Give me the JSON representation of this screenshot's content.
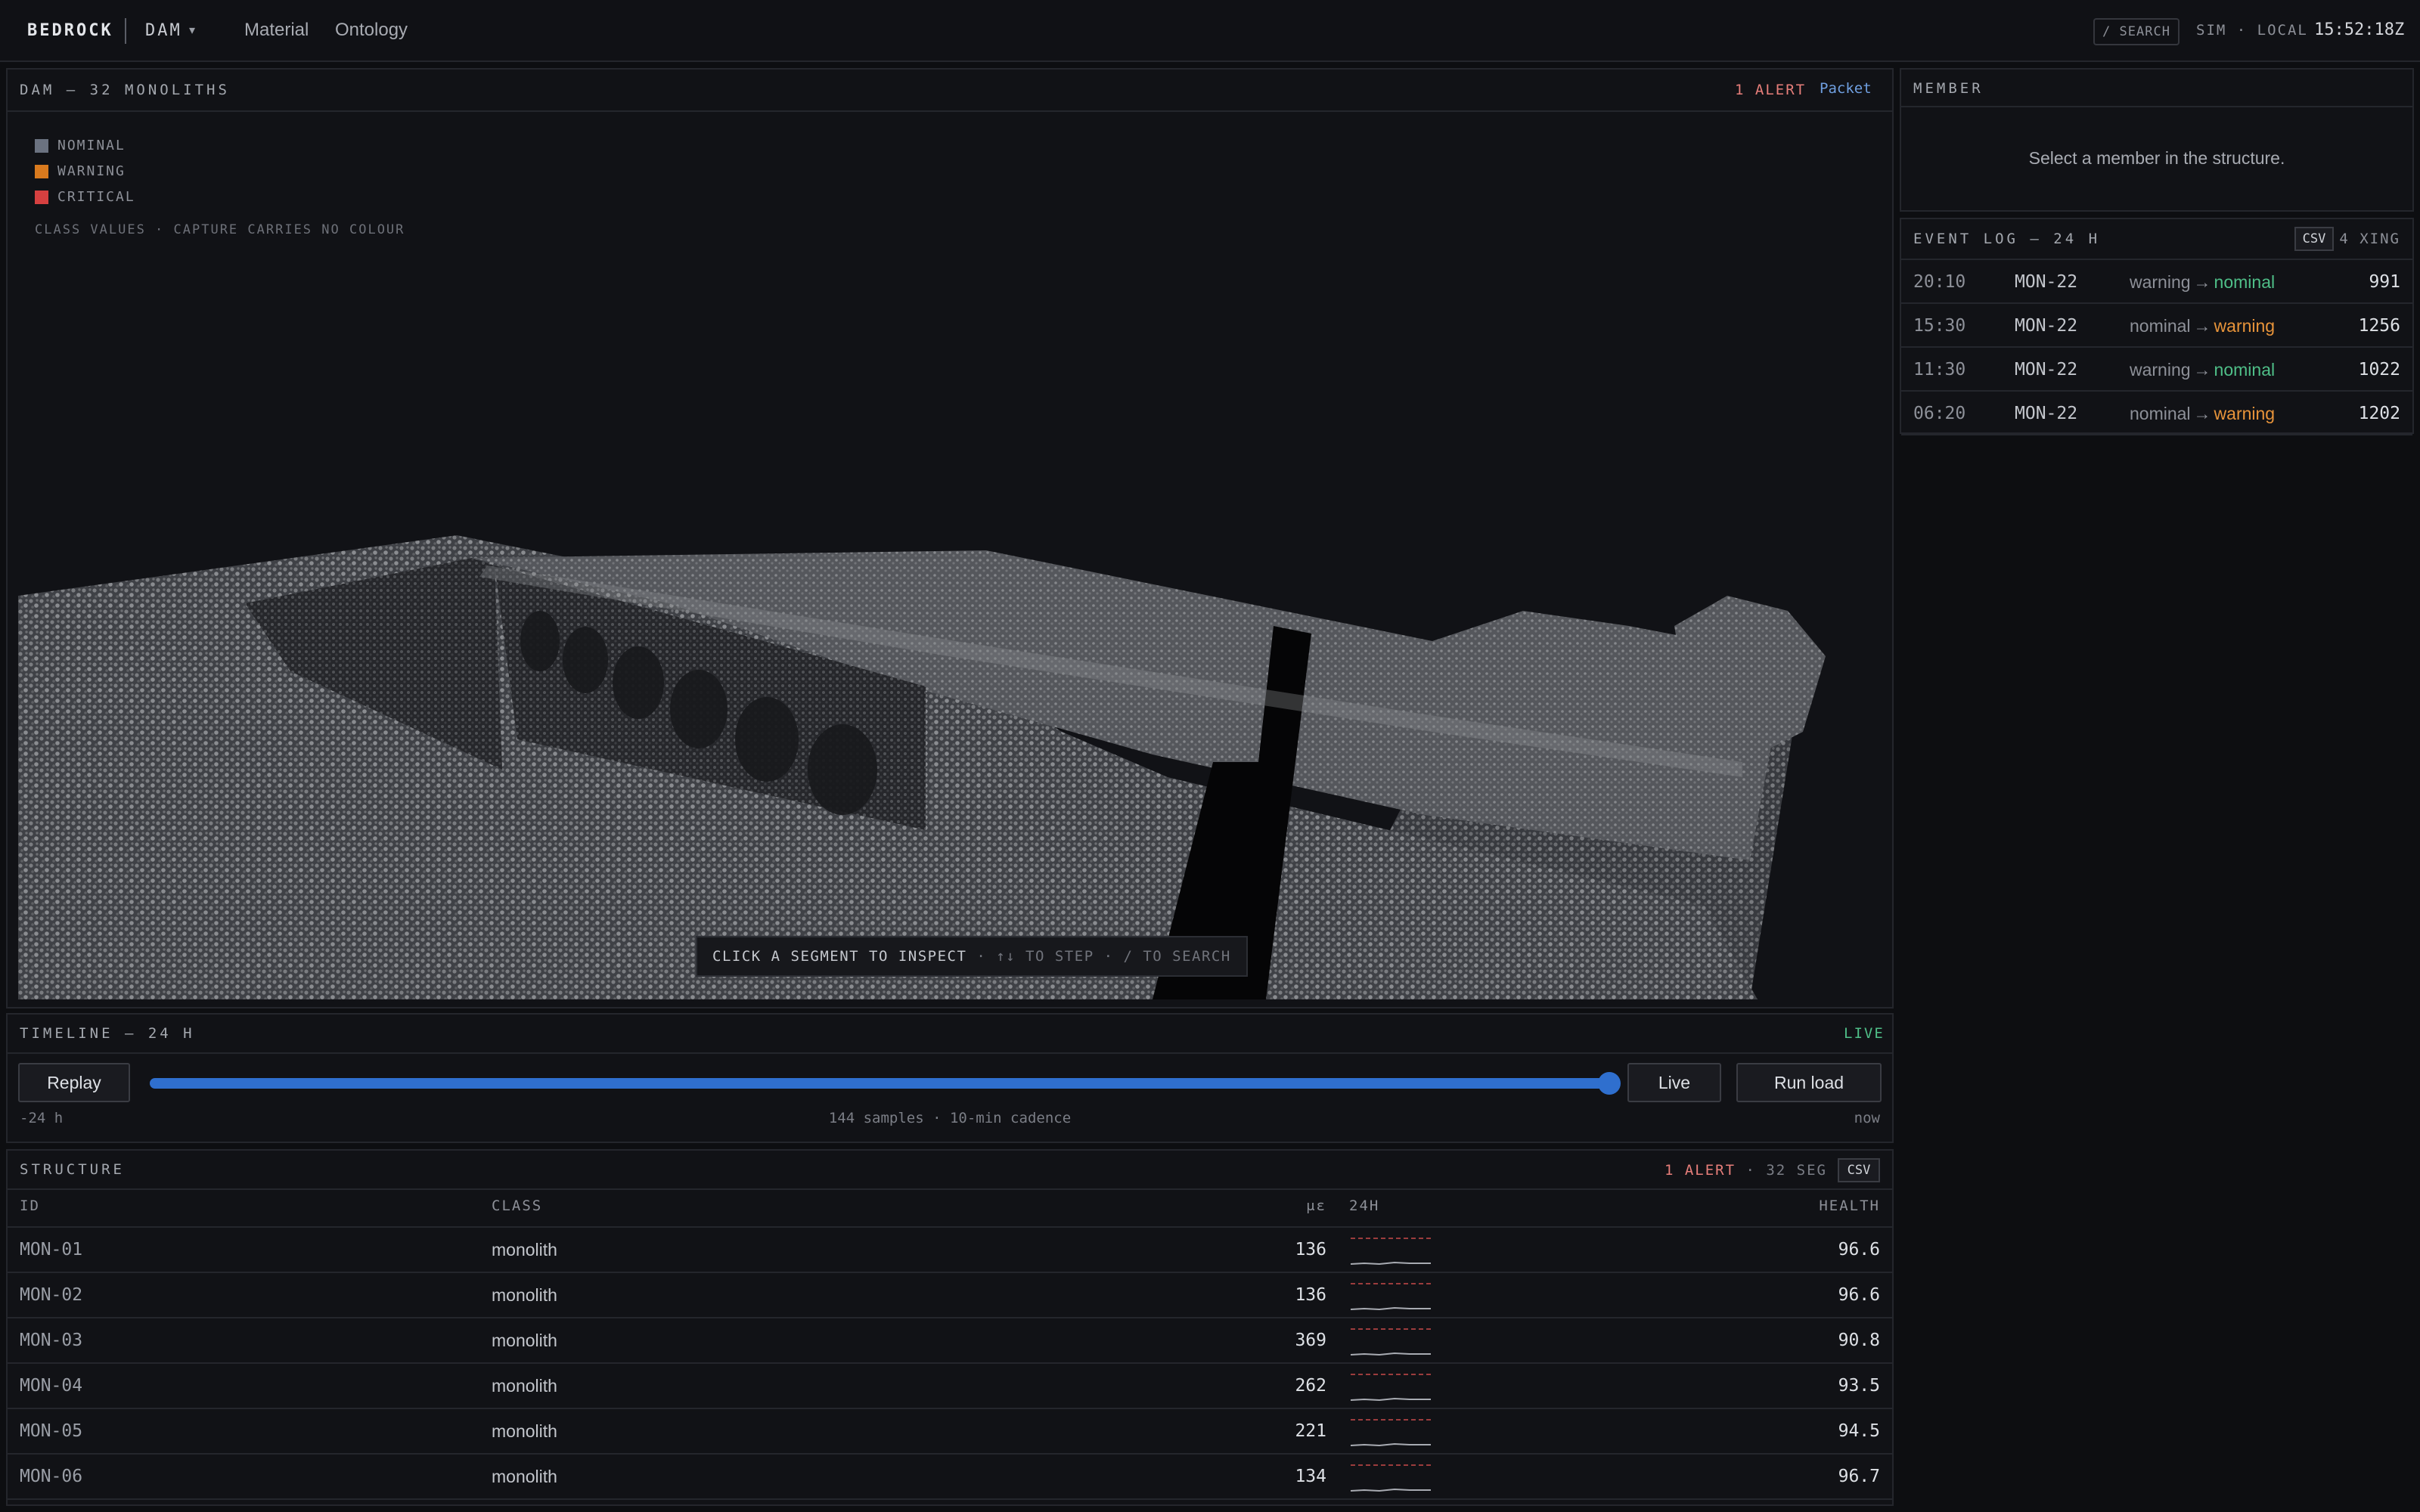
{
  "topbar": {
    "brand": "BEDROCK",
    "project": "DAM",
    "project_caret": "▾",
    "nav": [
      "Material",
      "Ontology"
    ],
    "search": "/ SEARCH",
    "env": "SIM · LOCAL",
    "clock": "15:52:18Z"
  },
  "viewport": {
    "title": "DAM — 32 MONOLITHS",
    "alert": "1 ALERT",
    "packet": "Packet",
    "legend": [
      {
        "label": "NOMINAL",
        "color": "#6b7280"
      },
      {
        "label": "WARNING",
        "color": "#d97a1e"
      },
      {
        "label": "CRITICAL",
        "color": "#d64040"
      }
    ],
    "legend_note": "CLASS VALUES · CAPTURE CARRIES NO COLOUR",
    "hint_a": "CLICK A SEGMENT TO INSPECT",
    "hint_b": " · ↑↓ TO STEP · / TO SEARCH"
  },
  "timeline": {
    "title": "TIMELINE — 24 H",
    "live_badge": "LIVE",
    "replay": "Replay",
    "live": "Live",
    "run_load": "Run load",
    "position": 1.0,
    "left_label": "-24 h",
    "center_label": "144 samples · 10-min cadence",
    "right_label": "now"
  },
  "structure": {
    "title": "STRUCTURE",
    "alert": "1 ALERT",
    "sep": " · ",
    "seg": "32 SEG",
    "csv": "CSV",
    "columns": {
      "id": "ID",
      "class": "CLASS",
      "ue": "με",
      "spark": "24H",
      "health": "HEALTH"
    },
    "rows": [
      {
        "id": "MON-01",
        "class": "monolith",
        "ue": "136",
        "health": "96.6"
      },
      {
        "id": "MON-02",
        "class": "monolith",
        "ue": "136",
        "health": "96.6"
      },
      {
        "id": "MON-03",
        "class": "monolith",
        "ue": "369",
        "health": "90.8"
      },
      {
        "id": "MON-04",
        "class": "monolith",
        "ue": "262",
        "health": "93.5"
      },
      {
        "id": "MON-05",
        "class": "monolith",
        "ue": "221",
        "health": "94.5"
      },
      {
        "id": "MON-06",
        "class": "monolith",
        "ue": "134",
        "health": "96.7"
      }
    ]
  },
  "member": {
    "title": "MEMBER",
    "empty": "Select a member in the structure."
  },
  "eventlog": {
    "title": "EVENT LOG — 24 H",
    "csv": "CSV",
    "xing": "4 XING",
    "arrow": "→",
    "rows": [
      {
        "time": "20:10",
        "id": "MON-22",
        "from": "warning",
        "to": "nominal",
        "value": "991"
      },
      {
        "time": "15:30",
        "id": "MON-22",
        "from": "nominal",
        "to": "warning",
        "value": "1256"
      },
      {
        "time": "11:30",
        "id": "MON-22",
        "from": "warning",
        "to": "nominal",
        "value": "1022"
      },
      {
        "time": "06:20",
        "id": "MON-22",
        "from": "nominal",
        "to": "warning",
        "value": "1202"
      }
    ]
  }
}
